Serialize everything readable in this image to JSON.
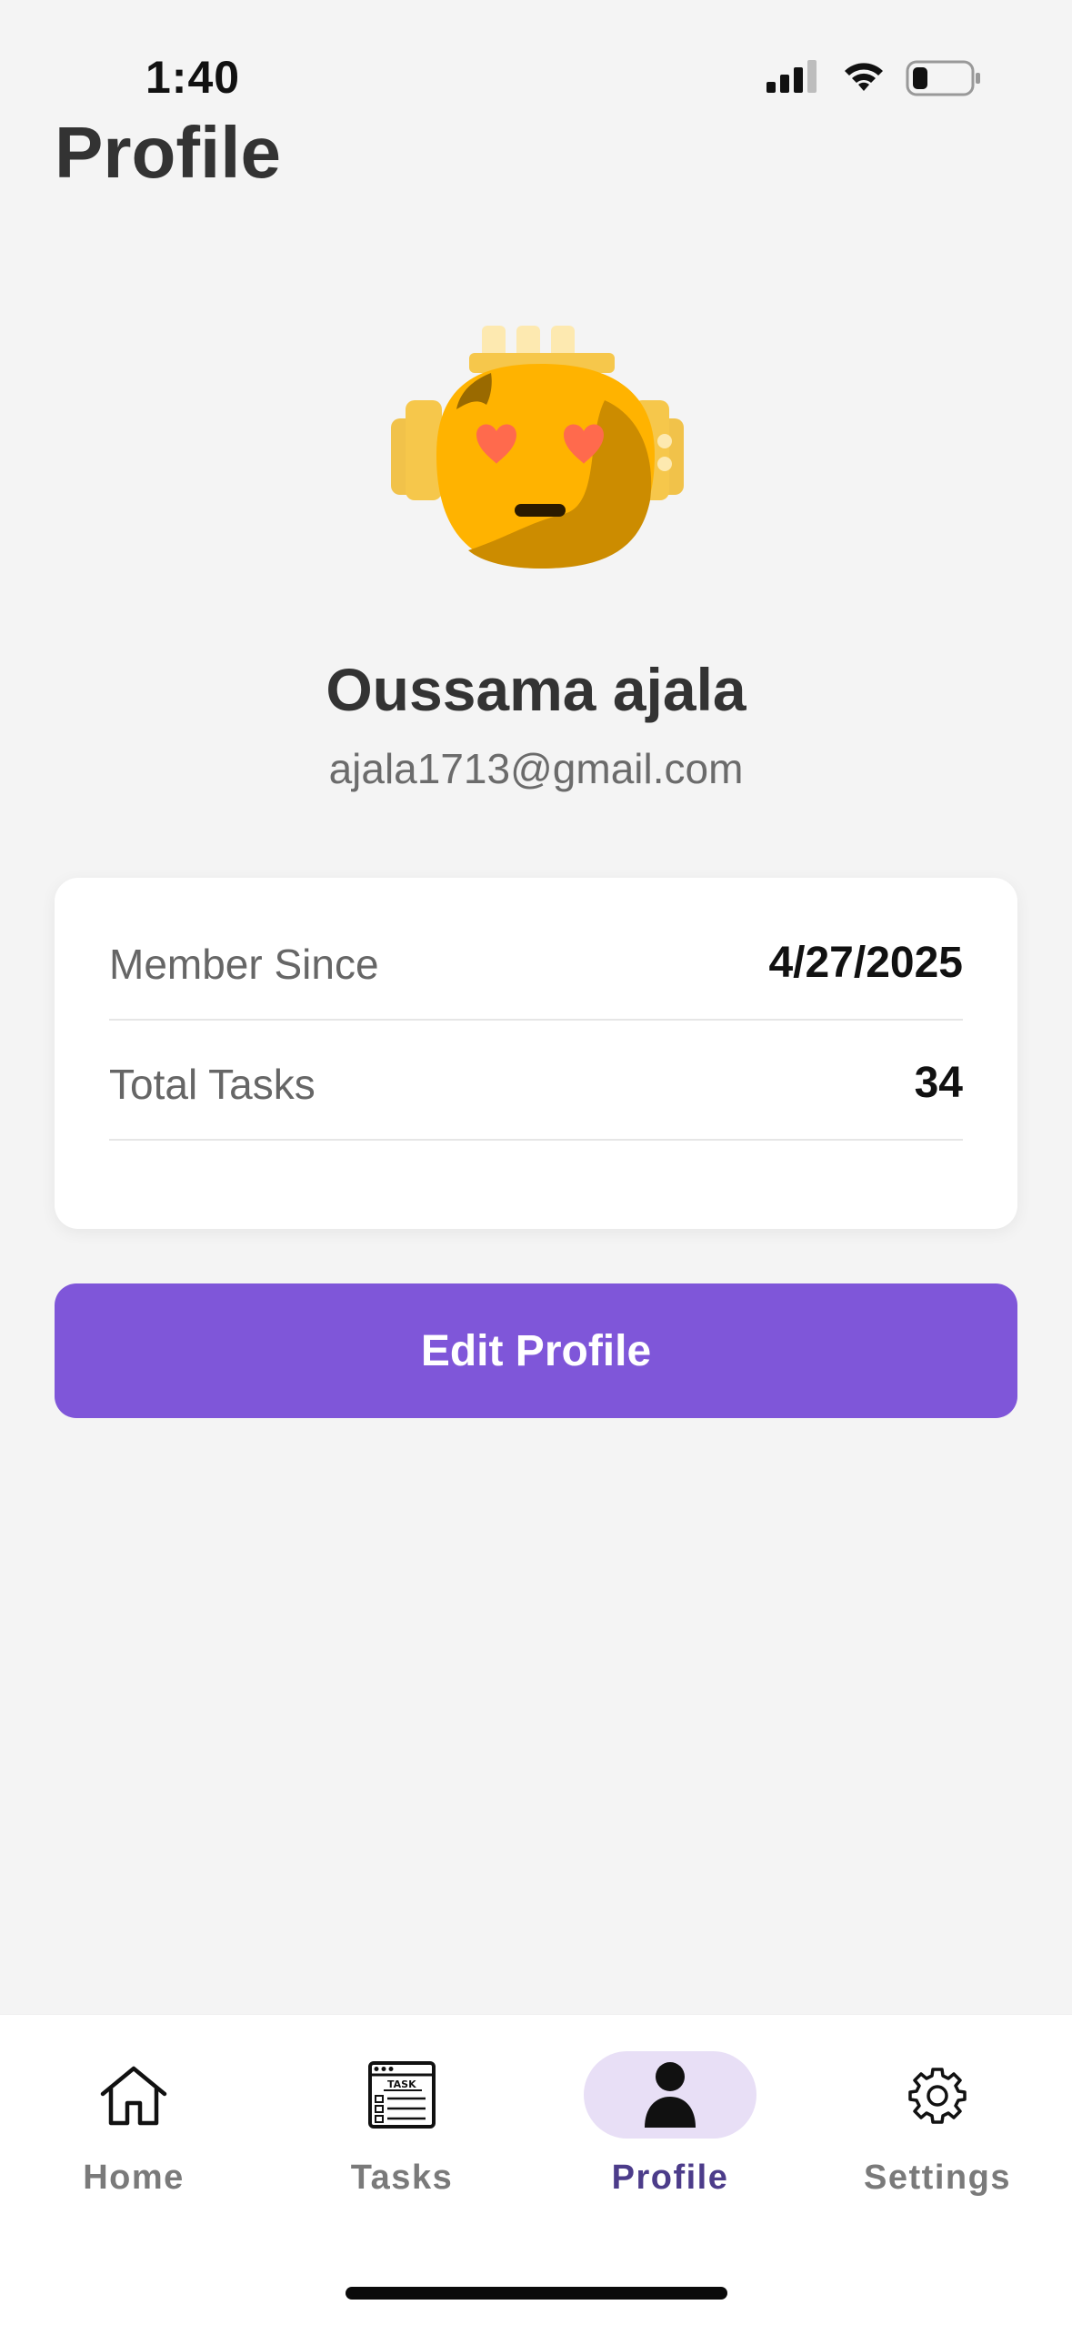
{
  "status_bar": {
    "time": "1:40",
    "icons": [
      "signal-icon",
      "wifi-icon",
      "battery-icon"
    ]
  },
  "page": {
    "title": "Profile"
  },
  "profile": {
    "avatar_icon": "robot-heart-eyes-avatar",
    "name": "Oussama ajala",
    "email": "ajala1713@gmail.com"
  },
  "info_card": {
    "rows": [
      {
        "label": "Member Since",
        "value": "4/27/2025"
      },
      {
        "label": "Total Tasks",
        "value": "34"
      }
    ]
  },
  "actions": {
    "edit_label": "Edit Profile"
  },
  "bottom_nav": {
    "items": [
      {
        "label": "Home",
        "icon": "home-icon"
      },
      {
        "label": "Tasks",
        "icon": "tasks-icon"
      },
      {
        "label": "Profile",
        "icon": "person-icon",
        "active": true
      },
      {
        "label": "Settings",
        "icon": "gear-icon"
      }
    ]
  },
  "colors": {
    "accent": "#7f56d9",
    "active_tab_bg": "#e8dff6",
    "background": "#f4f4f4"
  }
}
